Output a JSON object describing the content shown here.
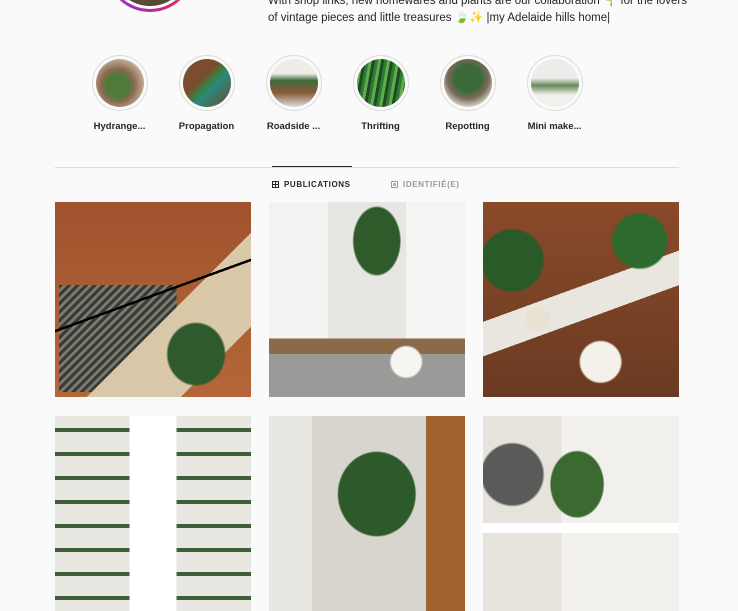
{
  "profile": {
    "bio_line1": "With shop links; new homewares and plants are our collaboration 🌱 for the lovers",
    "bio_line2": "of vintage pieces and little treasures 🍃✨ |my Adelaide hills home|"
  },
  "highlights": [
    {
      "label": "Hydrange..."
    },
    {
      "label": "Propagation"
    },
    {
      "label": "Roadside ..."
    },
    {
      "label": "Thrifting"
    },
    {
      "label": "Repotting"
    },
    {
      "label": "Mini make..."
    }
  ],
  "tabs": {
    "posts_label": "PUBLICATIONS",
    "tagged_label": "IDENTIFIÉ(E)"
  },
  "icons": {
    "posts": "grid-icon",
    "tagged": "tag-icon"
  },
  "colors": {
    "background": "#fafafa",
    "divider": "#dbdbdb",
    "text": "#262626",
    "muted": "#999999"
  }
}
